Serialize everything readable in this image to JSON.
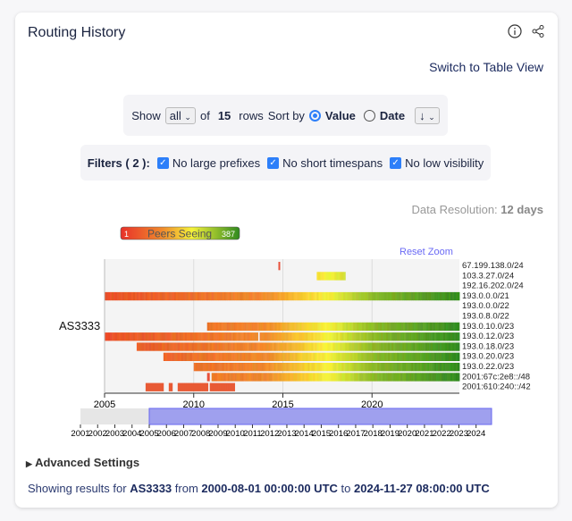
{
  "header": {
    "title": "Routing History",
    "info_icon": "info-icon",
    "share_icon": "share-icon",
    "switch_label": "Switch to Table View"
  },
  "controls": {
    "show_label": "Show",
    "show_value": "all",
    "of_label": "of",
    "total": "15",
    "rows_label": "rows",
    "sort_label": "Sort by",
    "sort_value": "Value",
    "sort_date": "Date",
    "sort_value_selected": true,
    "order": "↓"
  },
  "filters": {
    "label": "Filters ( 2 ):",
    "items": [
      {
        "label": "No large prefixes",
        "checked": true
      },
      {
        "label": "No short timespans",
        "checked": true
      },
      {
        "label": "No low visibility",
        "checked": true
      }
    ]
  },
  "resolution": {
    "label": "Data Resolution:",
    "value": "12 days"
  },
  "legend": {
    "title": "Peers Seeing",
    "min": "1",
    "max": "387",
    "colors": [
      "#e8312a",
      "#f08a2c",
      "#f5f23a",
      "#2f8a1e"
    ]
  },
  "reset_zoom": "Reset Zoom",
  "chart_data": {
    "type": "heatmap",
    "y_group_label": "AS3333",
    "x_ticks": [
      "2005",
      "2010",
      "2015",
      "2020"
    ],
    "xlim": [
      2005,
      2024.9
    ],
    "rows": [
      {
        "prefix": "67.199.138.0/24",
        "segments": [
          [
            2014.75,
            2014.85
          ]
        ]
      },
      {
        "prefix": "103.3.27.0/24",
        "segments": [
          [
            2016.9,
            2018.5
          ]
        ]
      },
      {
        "prefix": "192.16.202.0/24",
        "segments": []
      },
      {
        "prefix": "193.0.0.0/21",
        "segments": [
          [
            2005,
            2024.9
          ]
        ]
      },
      {
        "prefix": "193.0.0.0/22",
        "segments": []
      },
      {
        "prefix": "193.0.8.0/22",
        "segments": []
      },
      {
        "prefix": "193.0.10.0/23",
        "segments": [
          [
            2010.75,
            2024.9
          ]
        ]
      },
      {
        "prefix": "193.0.12.0/23",
        "segments": [
          [
            2005,
            2013.6
          ],
          [
            2013.7,
            2024.9
          ]
        ]
      },
      {
        "prefix": "193.0.18.0/23",
        "segments": [
          [
            2006.8,
            2024.9
          ]
        ]
      },
      {
        "prefix": "193.0.20.0/23",
        "segments": [
          [
            2008.3,
            2024.9
          ]
        ]
      },
      {
        "prefix": "193.0.22.0/23",
        "segments": [
          [
            2010,
            2024.9
          ]
        ]
      },
      {
        "prefix": "2001:67c:2e8::/48",
        "segments": [
          [
            2010.75,
            2010.9
          ],
          [
            2011,
            2024.9
          ]
        ]
      },
      {
        "prefix": "2001:610:240::/42",
        "segments": [
          [
            2007.3,
            2008.3
          ],
          [
            2008.6,
            2008.8
          ],
          [
            2009.1,
            2010.8
          ],
          [
            2010.9,
            2012.3
          ]
        ]
      }
    ],
    "brush": {
      "ticks": [
        "2001",
        "2002",
        "2003",
        "2004",
        "2005",
        "2006",
        "2007",
        "2008",
        "2009",
        "2010",
        "2011",
        "2012",
        "2013",
        "2014",
        "2015",
        "2016",
        "2017",
        "2018",
        "2019",
        "2020",
        "2021",
        "2022",
        "2023",
        "2024"
      ],
      "range": [
        2001,
        2024.9
      ],
      "selection": [
        2005,
        2024.9
      ]
    }
  },
  "advanced": "Advanced Settings",
  "footer": {
    "prefix": "Showing results for",
    "asn": "AS3333",
    "from_label": "from",
    "from": "2000-08-01 00:00:00 UTC",
    "to_label": "to",
    "to": "2024-11-27 08:00:00 UTC"
  }
}
